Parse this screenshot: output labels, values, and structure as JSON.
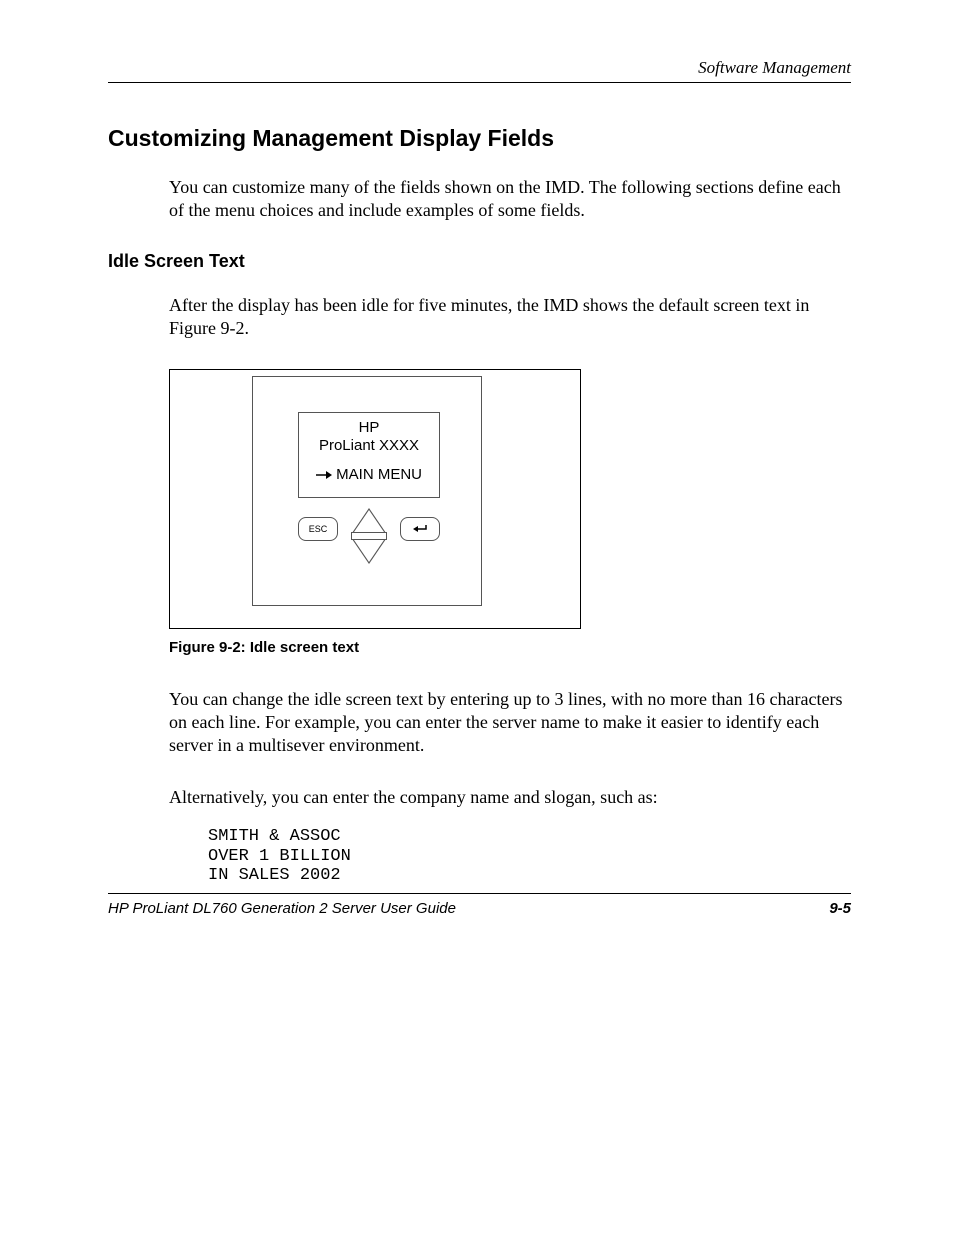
{
  "header": {
    "section": "Software Management"
  },
  "headings": {
    "h1": "Customizing Management Display Fields",
    "h2": "Idle Screen Text"
  },
  "paragraphs": {
    "p1": "You can customize many of the fields shown on the IMD. The following sections define each of the menu choices and include examples of some fields.",
    "p2": "After the display has been idle for five minutes, the IMD shows the default screen text in Figure 9-2.",
    "p3": "You can change the idle screen text by entering up to 3 lines, with no more than 16 characters on each line. For example, you can enter the server name to make it easier to identify each server in a multisever environment.",
    "p4": "Alternatively, you can enter the company name and slogan, such as:"
  },
  "figure": {
    "caption": "Figure 9-2:  Idle screen text",
    "lcd": {
      "line1": "HP",
      "line2": "ProLiant XXXX",
      "menu": "MAIN MENU"
    },
    "buttons": {
      "esc": "ESC"
    }
  },
  "code": {
    "line1": "SMITH & ASSOC",
    "line2": "OVER 1 BILLION",
    "line3": "IN SALES 2002"
  },
  "footer": {
    "title": "HP ProLiant DL760 Generation 2 Server User Guide",
    "page": "9-5"
  }
}
